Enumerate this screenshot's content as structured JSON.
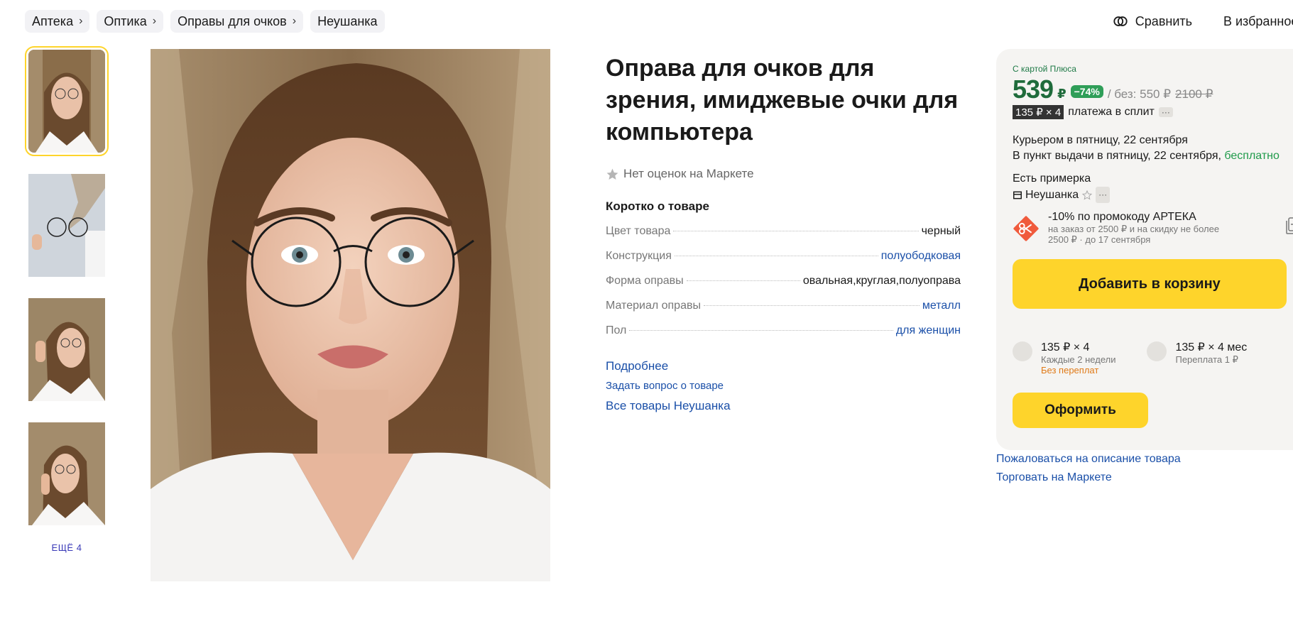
{
  "breadcrumbs": [
    {
      "label": "Аптека"
    },
    {
      "label": "Оптика"
    },
    {
      "label": "Оправы для очков"
    },
    {
      "label": "Неушанка"
    }
  ],
  "top_actions": {
    "compare": "Сравнить",
    "favorites": "В избранное"
  },
  "gallery": {
    "more_label": "ЕЩЁ 4"
  },
  "product": {
    "title": "Оправа для очков для зрения, имиджевые очки для компьютера",
    "rating_text": "Нет оценок на Маркете",
    "short_title": "Коротко о товаре",
    "specs": [
      {
        "key": "Цвет товара",
        "value": "черный"
      },
      {
        "key": "Конструкция",
        "value": "полуободковая"
      },
      {
        "key": "Форма оправы",
        "value": "овальная,круглая,полуоправа"
      },
      {
        "key": "Материал оправы",
        "value": "металл"
      },
      {
        "key": "Пол",
        "value": "для женщин"
      }
    ],
    "more_link": "Подробнее",
    "ask_link": "Задать вопрос о товаре",
    "all_seller_link": "Все товары Неушанка"
  },
  "buy": {
    "plus_label": "С картой Плюса",
    "price": "539",
    "currency": "₽",
    "discount": "−74%",
    "base_price": "/ без: 550 ₽",
    "old_price": "2100 ₽",
    "split_badge": "135 ₽ × 4",
    "split_text": "платежа в сплит",
    "more_dots": "···",
    "delivery_courier": "Курьером в пятницу, 22 сентября",
    "delivery_pickup": "В пункт выдачи в пятницу, 22 сентября,",
    "delivery_free": "бесплатно",
    "fitting": "Есть примерка",
    "seller": "Неушанка",
    "promo_title": "-10% по промокоду АРТЕКА",
    "promo_details": "на заказ от 2500 ₽ и на скидку не более 2500 ₽ · до 17 сентября",
    "add_to_cart": "Добавить в корзину",
    "plan1": {
      "amount": "135 ₽ × 4",
      "period": "Каждые 2 недели",
      "note": "Без переплат"
    },
    "plan2": {
      "amount": "135 ₽ × 4 мес",
      "period": "Переплата 1 ₽"
    },
    "checkout": "Оформить"
  },
  "links": {
    "complain": "Пожаловаться на описание товара",
    "sell": "Торговать на Маркете"
  },
  "colors": {
    "accent_yellow": "#fed42b",
    "price_green": "#1f6b3b",
    "link_blue": "#1a4fa8"
  }
}
